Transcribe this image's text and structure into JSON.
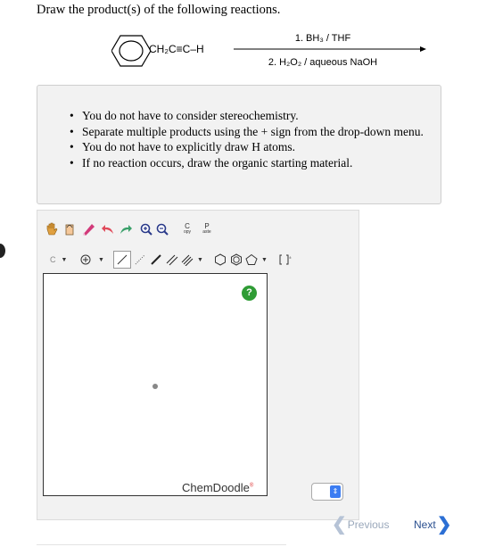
{
  "question": {
    "prompt": "Draw the product(s) of the following reactions."
  },
  "reaction": {
    "reactant": "CH₂C≡C–H",
    "conditions": [
      "1. BH₃ / THF",
      "2. H₂O₂ / aqueous NaOH"
    ]
  },
  "instructions": [
    "You do not have to consider stereochemistry.",
    "Separate multiple products using the + sign from the drop-down menu.",
    "You do not have to explicitly draw H atoms.",
    "If no reaction occurs, draw the organic starting material."
  ],
  "editor": {
    "toolbar_row1": [
      "hand-tool",
      "lasso-tool",
      "eraser-tool",
      "undo-tool",
      "redo-tool",
      "zoom-in-tool",
      "zoom-out-tool",
      "copy-tool",
      "paste-tool"
    ],
    "copy_label": [
      "C",
      "opy"
    ],
    "paste_label": [
      "P",
      "aste"
    ],
    "toolbar_row2": [
      "atom-label-tool",
      "charge-tool",
      "single-bond-tool",
      "bold-bond-tool",
      "wedge-bond-tool",
      "double-bond-tool",
      "cyclohexane-tool",
      "benzene-tool",
      "cyclopentane-tool",
      "bracket-tool"
    ],
    "atom_label": "C",
    "help_label": "?",
    "brand": "ChemDoodle",
    "brand_mark": "®"
  },
  "navigation": {
    "previous_label": "Previous",
    "next_label": "Next"
  }
}
